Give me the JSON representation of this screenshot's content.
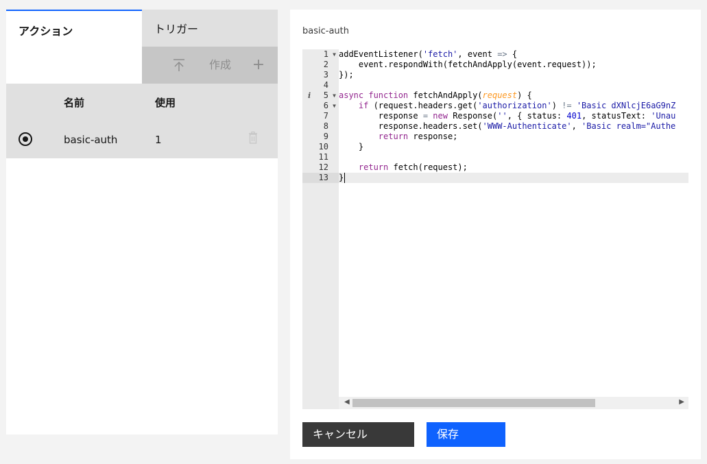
{
  "tabs": {
    "actions": "アクション",
    "triggers": "トリガー"
  },
  "toolbar": {
    "upload_icon": "upload-icon",
    "create": "作成",
    "add": "+"
  },
  "table": {
    "headers": {
      "name": "名前",
      "usage": "使用"
    },
    "rows": [
      {
        "name": "basic-auth",
        "usage": "1",
        "selected": true
      }
    ]
  },
  "editor": {
    "title": "basic-auth",
    "line_numbers": [
      "1",
      "2",
      "3",
      "4",
      "5",
      "6",
      "7",
      "8",
      "9",
      "10",
      "11",
      "12",
      "13"
    ],
    "active_line": 13,
    "code": [
      "addEventListener('fetch', event => {",
      "    event.respondWith(fetchAndApply(event.request));",
      "});",
      "",
      "async function fetchAndApply(request) {",
      "    if (request.headers.get('authorization') != 'Basic dXNlcjE6aG9nZ",
      "        response = new Response('', { status: 401, statusText: 'Unau",
      "        response.headers.set('WWW-Authenticate', 'Basic realm=\"Authe",
      "        return response;",
      "    }",
      "",
      "    return fetch(request);",
      "}"
    ]
  },
  "buttons": {
    "cancel": "キャンセル",
    "save": "保存"
  },
  "colors": {
    "accent": "#0f62fe",
    "dark_button": "#393939",
    "panel_gray": "#e0e0e0"
  }
}
